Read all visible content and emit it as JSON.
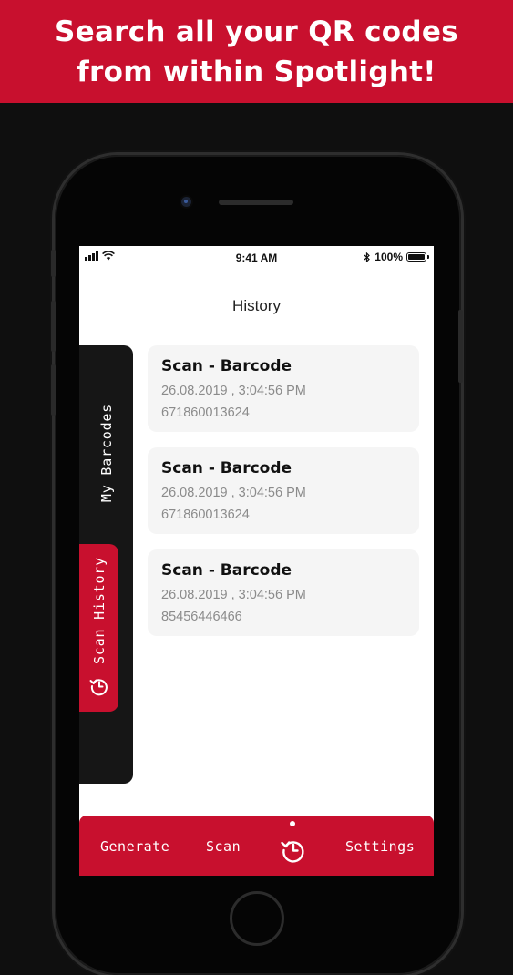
{
  "banner": {
    "line1": "Search all your QR codes",
    "line2": "from within Spotlight!"
  },
  "colors": {
    "brand_red": "#c8102e",
    "panel_dark": "#161616",
    "card_bg": "#f5f5f5"
  },
  "status_bar": {
    "time": "9:41 AM",
    "battery": "100%",
    "icons": [
      "signal-icon",
      "wifi-icon",
      "bluetooth-icon",
      "battery-icon"
    ]
  },
  "header": {
    "title": "History"
  },
  "side_tabs": {
    "my_barcodes": "My Barcodes",
    "scan_history": "Scan History",
    "scan_history_icon": "history-icon"
  },
  "history": [
    {
      "title": "Scan - Barcode",
      "date": "26.08.2019 , 3:04:56 PM",
      "code": "671860013624"
    },
    {
      "title": "Scan - Barcode",
      "date": "26.08.2019 , 3:04:56 PM",
      "code": "671860013624"
    },
    {
      "title": "Scan - Barcode",
      "date": "26.08.2019 , 3:04:56 PM",
      "code": "85456446466"
    }
  ],
  "bottom_nav": {
    "generate": "Generate",
    "scan": "Scan",
    "history_icon": "history-icon",
    "settings": "Settings"
  }
}
